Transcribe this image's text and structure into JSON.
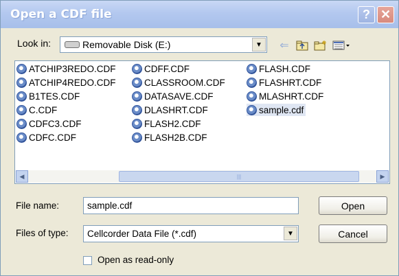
{
  "window": {
    "title": "Open a CDF file"
  },
  "lookin": {
    "label": "Look in:",
    "value": "Removable Disk (E:)"
  },
  "files": [
    {
      "name": "ATCHIP3REDO.CDF"
    },
    {
      "name": "ATCHIP4REDO.CDF"
    },
    {
      "name": "B1TES.CDF"
    },
    {
      "name": "C.CDF"
    },
    {
      "name": "CDFC3.CDF"
    },
    {
      "name": "CDFC.CDF"
    },
    {
      "name": "CDFF.CDF"
    },
    {
      "name": "CLASSROOM.CDF"
    },
    {
      "name": "DATASAVE.CDF"
    },
    {
      "name": "DLASHRT.CDF"
    },
    {
      "name": "FLASH2.CDF"
    },
    {
      "name": "FLASH2B.CDF"
    },
    {
      "name": "FLASH.CDF"
    },
    {
      "name": "FLASHRT.CDF"
    },
    {
      "name": "MLASHRT.CDF"
    },
    {
      "name": "sample.cdf",
      "selected": true
    }
  ],
  "filename": {
    "label": "File name:",
    "value": "sample.cdf"
  },
  "filetype": {
    "label": "Files of type:",
    "value": "Cellcorder Data File (*.cdf)"
  },
  "buttons": {
    "open": "Open",
    "cancel": "Cancel"
  },
  "readonly": {
    "label": "Open as read-only",
    "checked": false
  }
}
